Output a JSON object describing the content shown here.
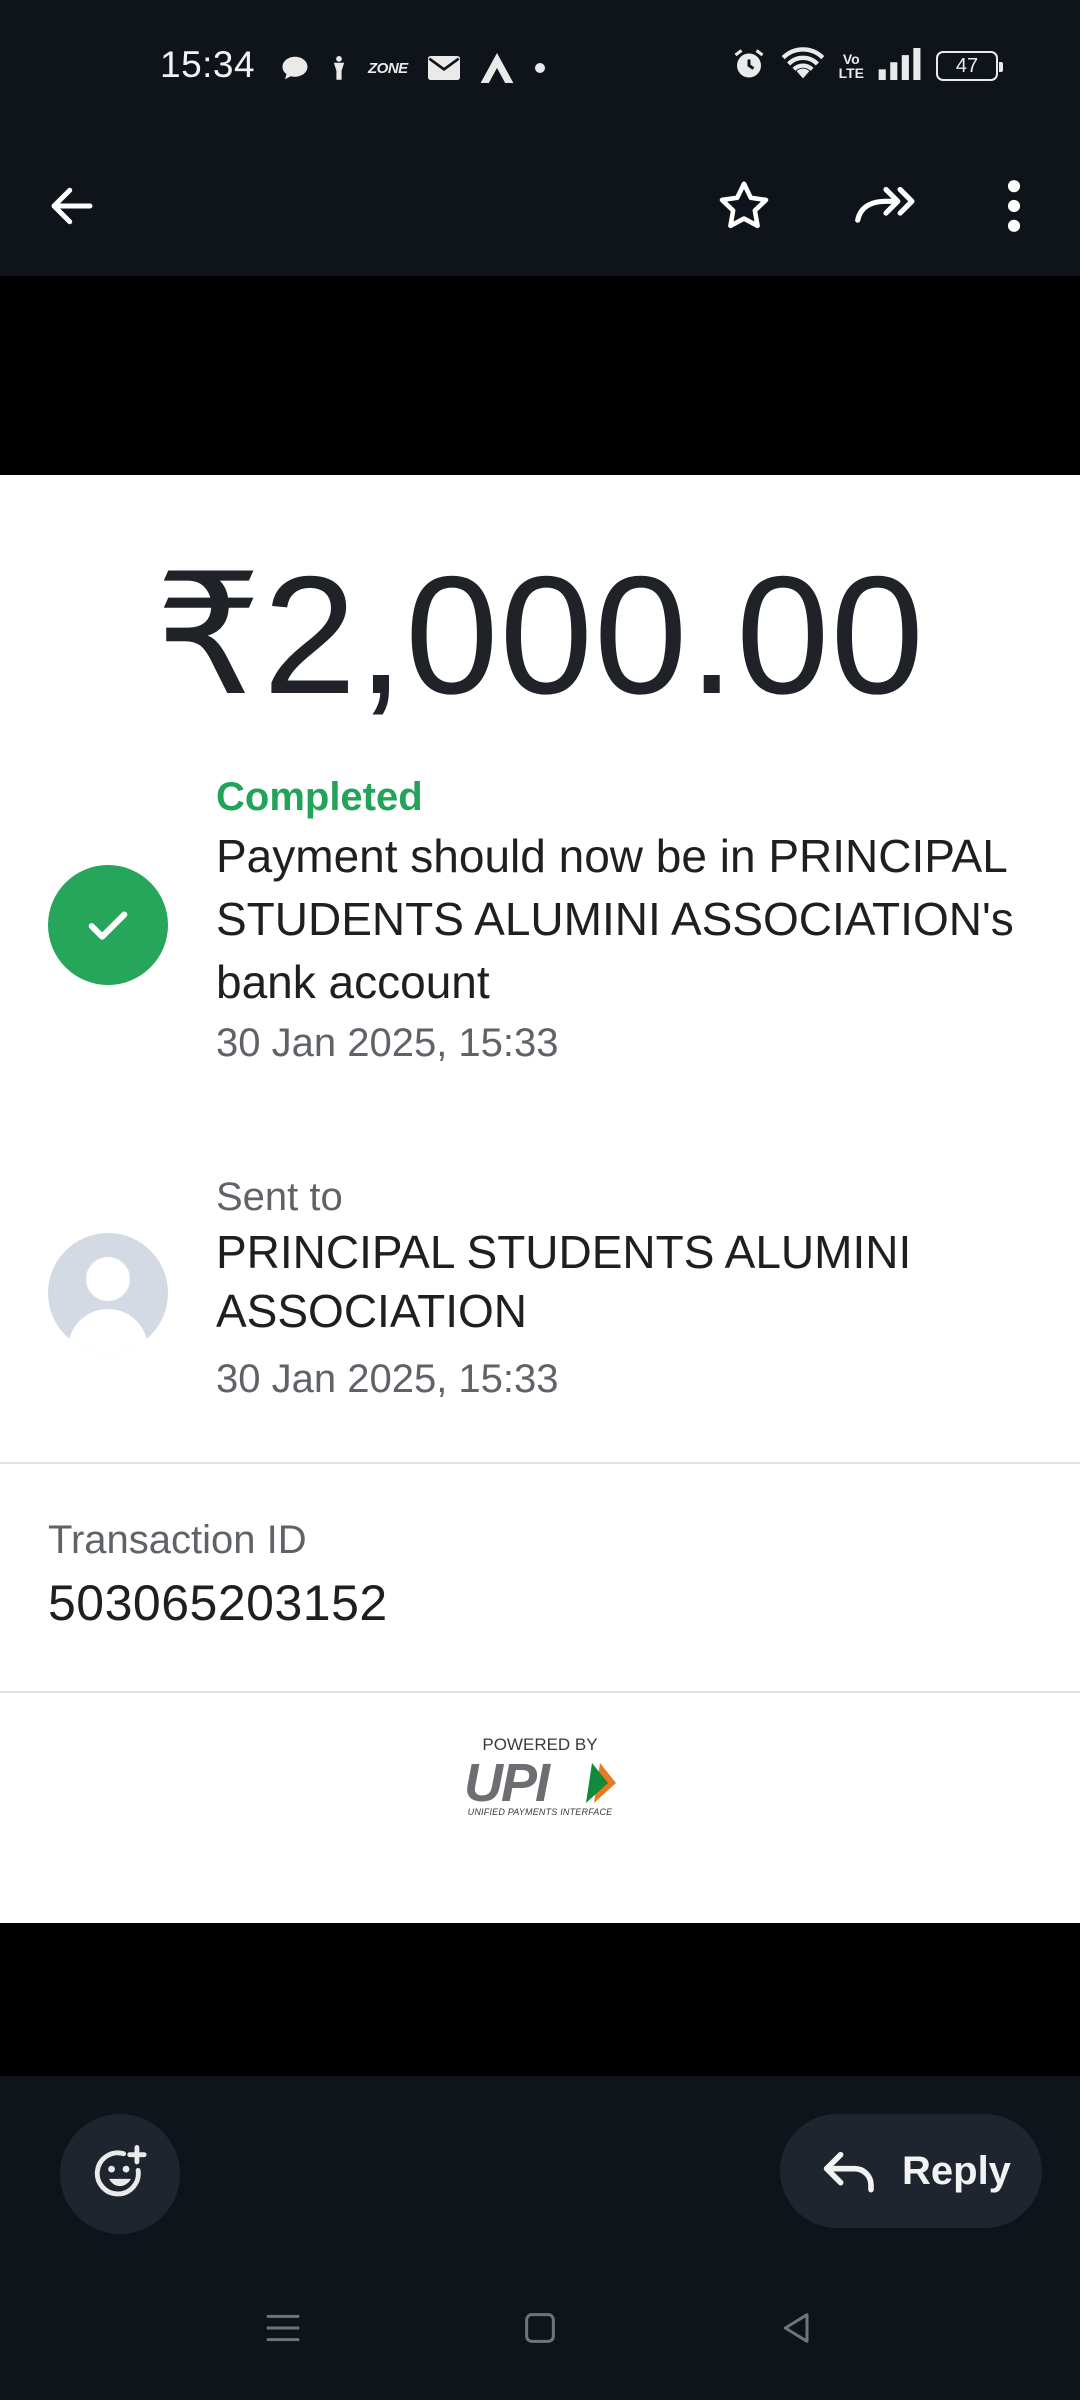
{
  "status_bar": {
    "time": "15:34",
    "notification_icons": [
      "chat-bubble-icon",
      "figure-icon",
      "zone-icon",
      "mail-icon",
      "arrow-logo-icon",
      "dot-icon"
    ],
    "zone_text": "ZONE",
    "volte": "Vo\nLTE",
    "battery": "47"
  },
  "app_bar": {
    "icons": [
      "back-arrow-icon",
      "star-icon",
      "forward-icon",
      "more-vert-icon"
    ]
  },
  "payment": {
    "amount": "₹2,000.00",
    "status_label": "Completed",
    "status_message": "Payment should now be in PRINCIPAL STUDENTS ALUMINI ASSOCIATION's bank account",
    "status_time": "30 Jan 2025, 15:33",
    "sent_label": "Sent to",
    "recipient_name": "PRINCIPAL STUDENTS ALUMINI ASSOCIATION",
    "recipient_time": "30 Jan 2025, 15:33",
    "transaction_label": "Transaction ID",
    "transaction_id": "503065203152"
  },
  "upi": {
    "powered_by": "POWERED BY",
    "logo_text": "UPI",
    "subtitle": "UNIFIED PAYMENTS INTERFACE"
  },
  "bottom": {
    "reply_label": "Reply"
  },
  "colors": {
    "success_green": "#26a65b",
    "dark_bg": "#0f141b"
  }
}
